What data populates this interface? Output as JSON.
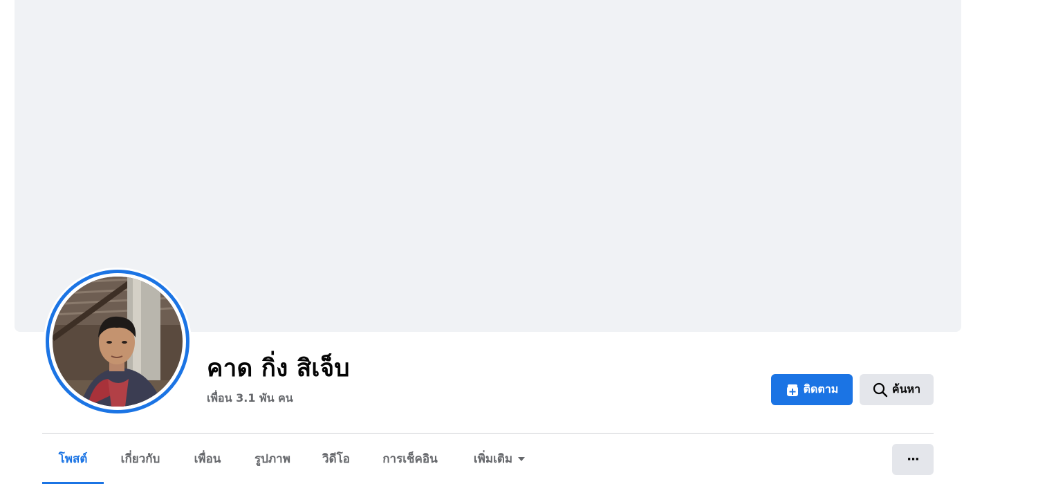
{
  "profile": {
    "name": "คาด กิ่ง สิเจ็บ",
    "friends_text": "เพื่อน 3.1 พัน คน"
  },
  "actions": {
    "follow_label": "ติดตาม",
    "search_label": "ค้นหา",
    "more_label": "···"
  },
  "tabs": [
    {
      "label": "โพสต์",
      "active": true
    },
    {
      "label": "เกี่ยวกับ",
      "active": false
    },
    {
      "label": "เพื่อน",
      "active": false
    },
    {
      "label": "รูปภาพ",
      "active": false
    },
    {
      "label": "วิดีโอ",
      "active": false
    },
    {
      "label": "การเช็คอิน",
      "active": false
    },
    {
      "label": "เพิ่มเติม",
      "active": false
    }
  ],
  "colors": {
    "accent": "#1b74e4",
    "cover": "#f0f2f5",
    "secondary_button": "#e4e6eb",
    "muted_text": "#65676b"
  },
  "icons": {
    "follow": "add-friend-plus-icon",
    "search": "search-icon",
    "more": "dropdown-caret-icon"
  }
}
